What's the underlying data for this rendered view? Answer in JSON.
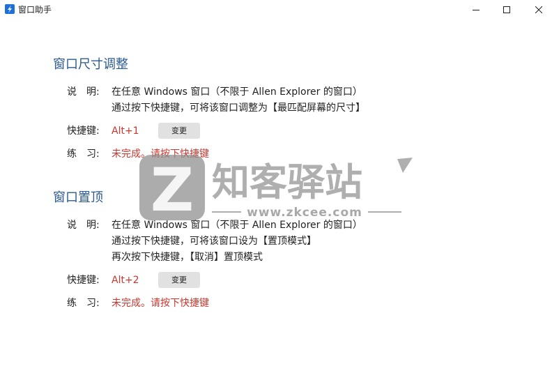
{
  "window": {
    "title": "窗口助手"
  },
  "section1": {
    "title": "窗口尺寸调整",
    "desc_label": "说　明:",
    "desc_lines": [
      "在任意 Windows 窗口（不限于 Allen Explorer 的窗口）",
      "通过按下快捷键，可将该窗口调整为【最匹配屏幕的尺寸】"
    ],
    "shortcut_label": "快捷键:",
    "shortcut_value": "Alt+1",
    "change_label": "变更",
    "practice_label": "练　习:",
    "practice_status": "未完成。请按下快捷键"
  },
  "section2": {
    "title": "窗口置顶",
    "desc_label": "说　明:",
    "desc_lines": [
      "在任意 Windows 窗口（不限于 Allen Explorer 的窗口）",
      "通过按下快捷键，可将该窗口设为【置顶模式】",
      "再次按下快捷键，【取消】置顶模式"
    ],
    "shortcut_label": "快捷键:",
    "shortcut_value": "Alt+2",
    "change_label": "变更",
    "practice_label": "练　习:",
    "practice_status": "未完成。请按下快捷键"
  },
  "watermark": {
    "brand": "知客驿站",
    "url": "www.zkcee.com",
    "letter": "Z"
  },
  "colors": {
    "heading": "#2b5a93",
    "status_red": "#c7372f",
    "button_bg": "#e1e1e1"
  }
}
